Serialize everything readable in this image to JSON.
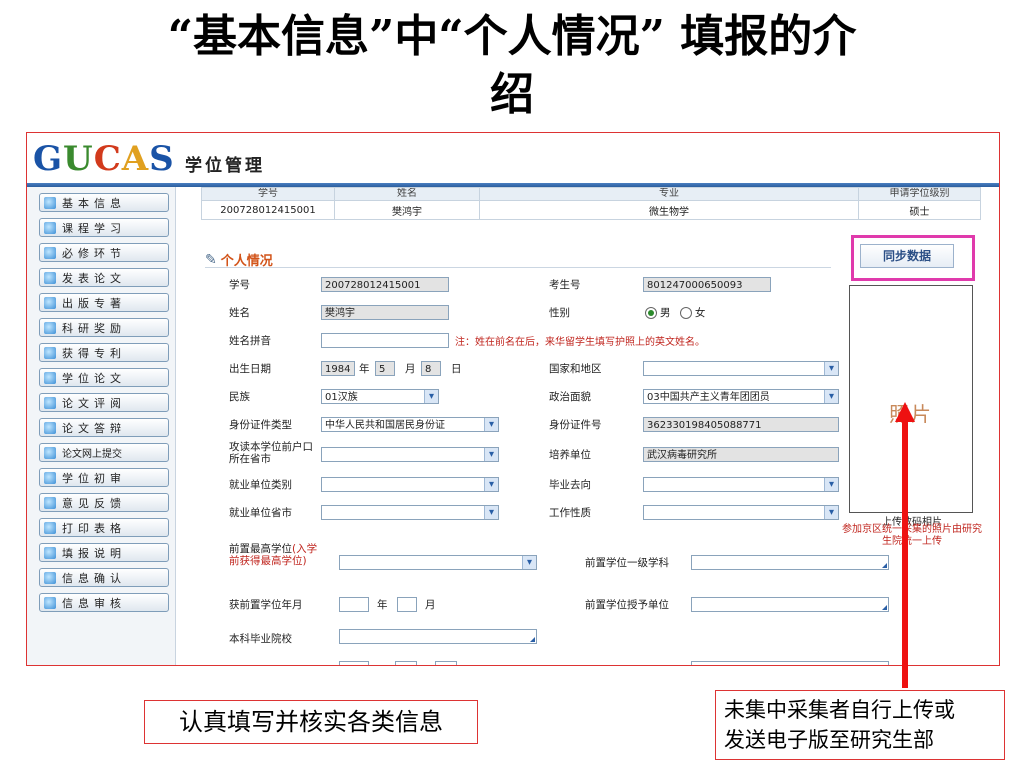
{
  "slide": {
    "title_line1": "“基本信息”中“个人情况” 填报的介",
    "title_line2": "绍",
    "callout_left": "认真填写并核实各类信息",
    "callout_right_line1": "未集中采集者自行上传或",
    "callout_right_line2": "发送电子版至研究生部"
  },
  "app": {
    "logo_g": "G",
    "logo_u": "U",
    "logo_c": "C",
    "logo_a": "A",
    "logo_s": "S",
    "name": "学位管理"
  },
  "sidebar": {
    "items": [
      {
        "label": "基本信息"
      },
      {
        "label": "课程学习"
      },
      {
        "label": "必修环节"
      },
      {
        "label": "发表论文"
      },
      {
        "label": "出版专著"
      },
      {
        "label": "科研奖励"
      },
      {
        "label": "获得专利"
      },
      {
        "label": "学位论文"
      },
      {
        "label": "论文评阅"
      },
      {
        "label": "论文答辩"
      },
      {
        "label": "论文网上提交"
      },
      {
        "label": "学位初审"
      },
      {
        "label": "意见反馈"
      },
      {
        "label": "打印表格"
      },
      {
        "label": "填报说明"
      },
      {
        "label": "信息确认"
      },
      {
        "label": "信息审核"
      }
    ]
  },
  "summary": {
    "headers": [
      "学号",
      "姓名",
      "专业",
      "申请学位级别"
    ],
    "values": [
      "200728012415001",
      "樊鸿宇",
      "微生物学",
      "硕士"
    ]
  },
  "section": {
    "title": "个人情况",
    "sync_button": "同步数据",
    "photo_label": "照片",
    "upload_hint": "上传数码相片",
    "upload_note": "参加京区统一采集的照片由研究生院统一上传"
  },
  "form": {
    "student_id_label": "学号",
    "student_id": "200728012415001",
    "exam_no_label": "考生号",
    "exam_no": "801247000650093",
    "name_label": "姓名",
    "name": "樊鸿宇",
    "gender_label": "性别",
    "gender_male": "男",
    "gender_female": "女",
    "pinyin_label": "姓名拼音",
    "pinyin": "",
    "pinyin_note": "注：姓在前名在后，来华留学生填写护照上的英文姓名。",
    "birth_label": "出生日期",
    "birth_year": "1984",
    "birth_year_unit": "年",
    "birth_month": "5",
    "birth_month_unit": "月",
    "birth_day": "8",
    "birth_day_unit": "日",
    "country_label": "国家和地区",
    "country": "",
    "ethnic_label": "民族",
    "ethnic": "01汉族",
    "political_label": "政治面貌",
    "political": "03中国共产主义青年团团员",
    "idtype_label": "身份证件类型",
    "idtype": "中华人民共和国居民身份证",
    "idno_label": "身份证件号",
    "idno": "362330198405088771",
    "hukou_label": "攻读本学位前户口所在省市",
    "hukou": "",
    "unit_label": "培养单位",
    "unit": "武汉病毒研究所",
    "jobtype_label": "就业单位类别",
    "jobtype": "",
    "dest_label": "毕业去向",
    "dest": "",
    "jobprov_label": "就业单位省市",
    "jobprov": "",
    "jobnature_label": "工作性质",
    "jobnature": "",
    "prev_degree_label": "前置最高学位",
    "prev_degree_note": "(入学前获得最高学位)",
    "prev_degree": "",
    "prev_subject_label": "前置学位一级学科",
    "prev_subject": "",
    "prev_date_label": "获前置学位年月",
    "prev_year_unit": "年",
    "prev_month_unit": "月",
    "prev_grant_label": "前置学位授予单位",
    "prev_grant": "",
    "undergrad_label": "本科毕业院校",
    "undergrad": ""
  },
  "colors": {
    "accent_red": "#ee1111",
    "section_orange": "#d2541a",
    "sync_border": "#e03aac",
    "header_blue": "#2b5e9e"
  }
}
